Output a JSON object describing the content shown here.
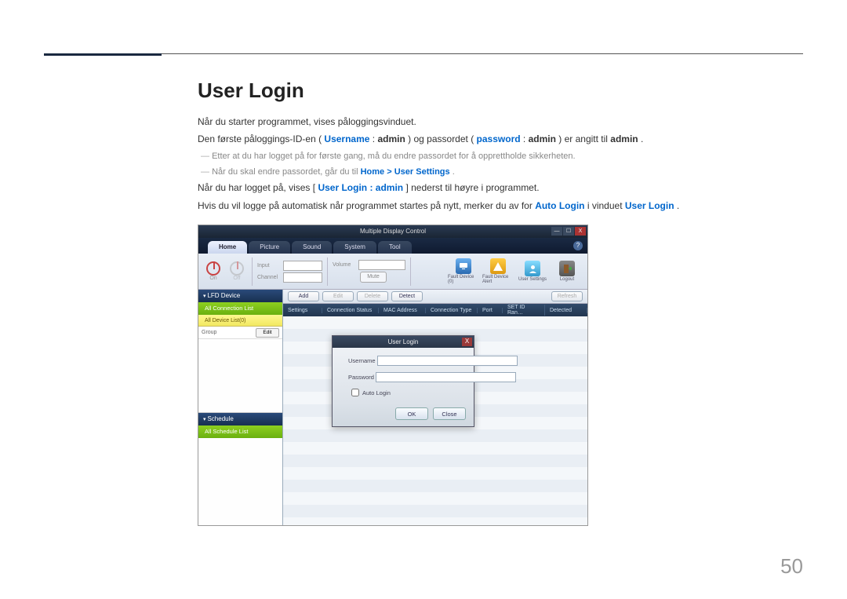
{
  "page": {
    "heading": "User Login",
    "line1_a": "Når du starter programmet, vises påloggingsvinduet.",
    "line2": {
      "a": "Den første påloggings-ID-en (",
      "b": "Username",
      "c": ": ",
      "d": "admin",
      "e": ") og passordet (",
      "f": "password",
      "g": ": ",
      "h": "admin",
      "i": ") er angitt til ",
      "j": "admin",
      "k": "."
    },
    "sub1": "Etter at du har logget på for første gang, må du endre passordet for å opprettholde sikkerheten.",
    "sub2": {
      "a": "Når du skal endre passordet, går du til ",
      "b": "Home",
      "c": " > ",
      "d": "User Settings",
      "e": "."
    },
    "line3": {
      "a": "Når du har logget på, vises [",
      "b": "User Login : admin",
      "c": "] nederst til høyre i programmet."
    },
    "line4": {
      "a": "Hvis du vil logge på automatisk når programmet startes på nytt, merker du av for ",
      "b": "Auto Login",
      "c": " i vinduet ",
      "d": "User Login",
      "e": "."
    },
    "number": "50"
  },
  "app": {
    "title": "Multiple Display Control",
    "tabs": [
      "Home",
      "Picture",
      "Sound",
      "System",
      "Tool"
    ],
    "ribbon": {
      "on": "On",
      "off": "Off",
      "input": "Input",
      "channel": "Channel",
      "volume": "Volume",
      "mute": "Mute",
      "faultDevice": "Fault Device (0)",
      "faultAlert": "Fault Device Alert",
      "userSettings": "User Settings",
      "logout": "Logout"
    },
    "sidebar": {
      "lfd": "LFD Device",
      "allConn": "All Connection List",
      "allDev": "All Device List(0)",
      "group": "Group",
      "edit": "Edit",
      "schedule": "Schedule",
      "allSched": "All Schedule List"
    },
    "toolbar": {
      "add": "Add",
      "edit": "Edit",
      "delete": "Delete",
      "detect": "Detect",
      "refresh": "Refresh"
    },
    "cols": [
      "Settings",
      "Connection Status",
      "MAC Address",
      "Connection Type",
      "Port",
      "SET ID Ran…",
      "Detected"
    ],
    "dialog": {
      "title": "User Login",
      "username": "Username",
      "password": "Password",
      "autologin": "Auto Login",
      "ok": "OK",
      "close": "Close"
    }
  }
}
